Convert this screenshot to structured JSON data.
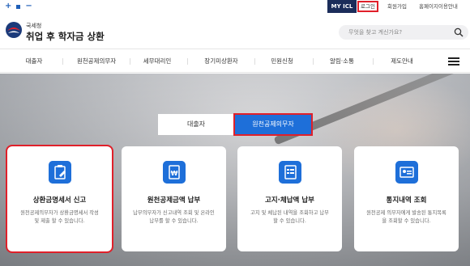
{
  "topbar": {
    "zoom": {
      "plus": "+",
      "minus": "−"
    },
    "myicl": "MY ICL",
    "login": "로그인",
    "signup": "회원가입",
    "sitemap": "홈페이지이용안내"
  },
  "header": {
    "agency": "국세청",
    "title": "취업 후 학자금 상환",
    "search_placeholder": "무엇을 찾고 계신가요?"
  },
  "nav": {
    "items": [
      "대출자",
      "원천공제의무자",
      "세무대리인",
      "장기미상환자",
      "민원신청",
      "알림·소통",
      "제도안내"
    ]
  },
  "hero": {
    "tabs": [
      "대출자",
      "원천공제의무자"
    ],
    "cards": [
      {
        "title": "상환금명세서 신고",
        "desc": "원천공제의무자가 상환금명세서 작성 및 제출 할 수 있습니다."
      },
      {
        "title": "원천공제금액 납부",
        "desc": "납부의무자가 신고내역 조회 및 온라인납부를 할 수 있습니다."
      },
      {
        "title": "고지·체납액 납부",
        "desc": "고지 및 체납된 내역을 조회하고 납부할 수 있습니다."
      },
      {
        "title": "통지내역 조회",
        "desc": "원천공제 의무자에게 발송된 통지목록을 조회할 수 있습니다."
      }
    ]
  }
}
